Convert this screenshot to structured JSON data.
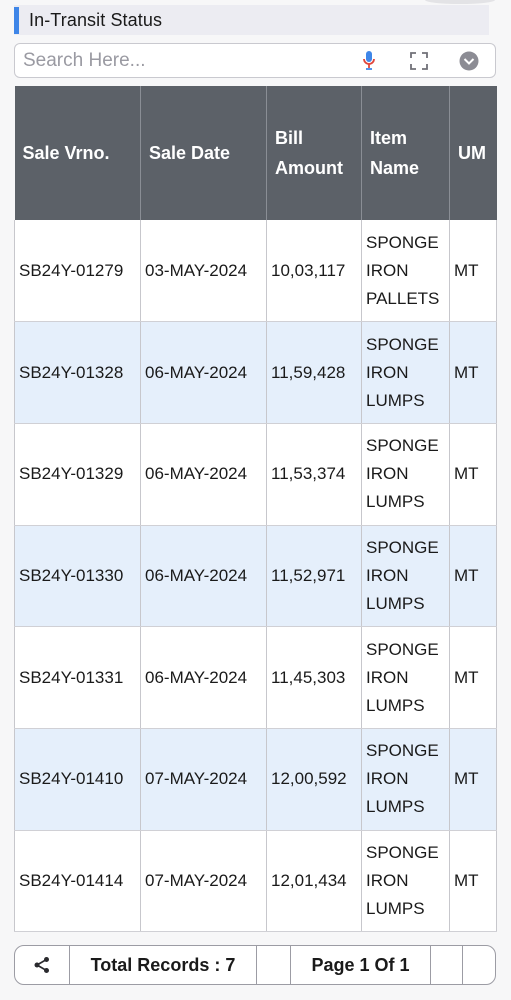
{
  "header": {
    "title": "In-Transit Status"
  },
  "search": {
    "placeholder": "Search Here..."
  },
  "icons": {
    "mic": "mic-icon",
    "expand": "expand-icon",
    "dropdown": "chevron-down-icon",
    "share": "share-icon"
  },
  "colors": {
    "accent": "#3f86e8",
    "header_bg": "#5c6168",
    "alt_row": "#e5effb",
    "mic_blue": "#3f86e8",
    "mic_red": "#e0453a"
  },
  "table": {
    "columns": [
      "Sale Vrno.",
      "Sale Date",
      "Bill Amount",
      "Item Name",
      "UM"
    ],
    "rows": [
      {
        "vrno": "SB24Y-01279",
        "date": "03-MAY-2024",
        "amount": "10,03,117",
        "item": "SPONGE IRON PALLETS",
        "um": "MT"
      },
      {
        "vrno": "SB24Y-01328",
        "date": "06-MAY-2024",
        "amount": "11,59,428",
        "item": "SPONGE IRON LUMPS",
        "um": "MT"
      },
      {
        "vrno": "SB24Y-01329",
        "date": "06-MAY-2024",
        "amount": "11,53,374",
        "item": "SPONGE IRON LUMPS",
        "um": "MT"
      },
      {
        "vrno": "SB24Y-01330",
        "date": "06-MAY-2024",
        "amount": "11,52,971",
        "item": "SPONGE IRON LUMPS",
        "um": "MT"
      },
      {
        "vrno": "SB24Y-01331",
        "date": "06-MAY-2024",
        "amount": "11,45,303",
        "item": "SPONGE IRON LUMPS",
        "um": "MT"
      },
      {
        "vrno": "SB24Y-01410",
        "date": "07-MAY-2024",
        "amount": "12,00,592",
        "item": "SPONGE IRON LUMPS",
        "um": "MT"
      },
      {
        "vrno": "SB24Y-01414",
        "date": "07-MAY-2024",
        "amount": "12,01,434",
        "item": "SPONGE IRON LUMPS",
        "um": "MT"
      }
    ]
  },
  "footer": {
    "total_records": "Total Records : 7",
    "page_info": "Page 1 Of 1"
  }
}
